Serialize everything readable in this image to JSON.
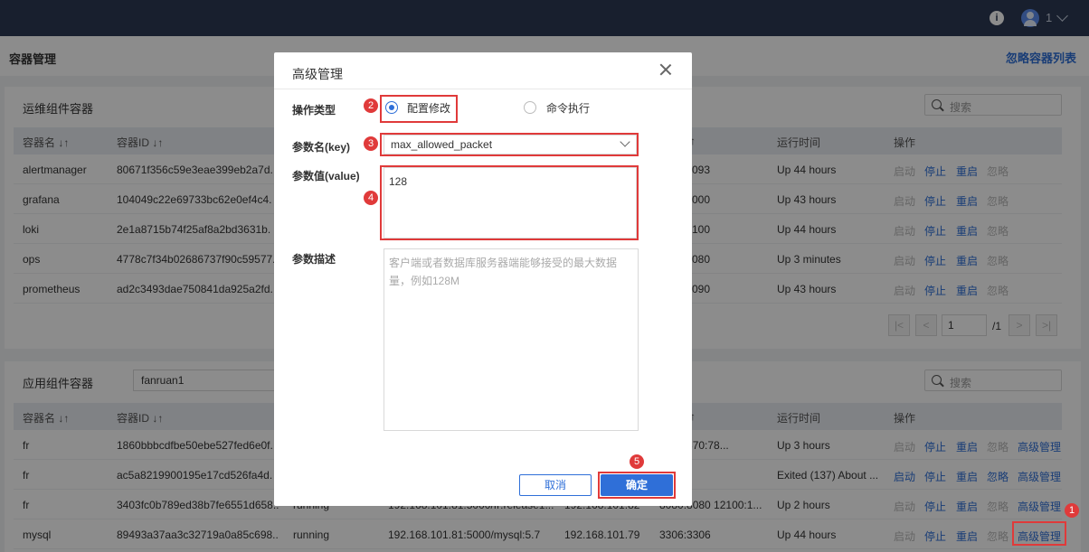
{
  "topbar": {
    "info": "i",
    "user": "1"
  },
  "page": {
    "title": "容器管理",
    "ignore_list": "忽略容器列表"
  },
  "panel1": {
    "title": "运维组件容器",
    "search_placeholder": "搜索",
    "headers": [
      "容器名 ↓↑",
      "容器ID ↓↑",
      "↑",
      "运行时间",
      "操作"
    ],
    "rows": [
      {
        "name": "alertmanager",
        "id": "80671f356c59e3eae399eb2a7d.",
        "port": "093",
        "uptime": "Up 44 hours"
      },
      {
        "name": "grafana",
        "id": "104049c22e69733bc62e0ef4c4.",
        "port": "000",
        "uptime": "Up 43 hours"
      },
      {
        "name": "loki",
        "id": "2e1a8715b74f25af8a2bd3631b.",
        "port": "100",
        "uptime": "Up 44 hours"
      },
      {
        "name": "ops",
        "id": "4778c7f34b02686737f90c59577.",
        "port": "080",
        "uptime": "Up 3 minutes"
      },
      {
        "name": "prometheus",
        "id": "ad2c3493dae750841da925a2fd.",
        "port": "090",
        "uptime": "Up 43 hours"
      }
    ],
    "actions": {
      "start": "启动",
      "stop": "停止",
      "restart": "重启",
      "ignore": "忽略"
    },
    "pager": {
      "first": "|<",
      "prev": "<",
      "page": "1",
      "total": "/1",
      "next": ">",
      "last": ">|"
    }
  },
  "panel2": {
    "title": "应用组件容器",
    "filter": "fanruan1",
    "search_placeholder": "搜索",
    "headers": [
      "容器名 ↓↑",
      "容器ID ↓↑",
      "↑",
      "运行时间",
      "操作"
    ],
    "rows": [
      {
        "name": "fr",
        "id": "1860bbbcdfbe50ebe527fed6e0f.",
        "status": "",
        "image": "",
        "ip": "",
        "port": "850 7870:78...",
        "uptime": "Up 3 hours"
      },
      {
        "name": "fr",
        "id": "ac5a8219900195e17cd526fa4d.",
        "status": "",
        "image": "",
        "ip": "",
        "port": "",
        "uptime": "Exited (137) About ..."
      },
      {
        "name": "fr",
        "id": "3403fc0b789ed38b7fe6551d658...",
        "status": "running",
        "image": "192.168.101.81:5000/fr:release1...",
        "ip": "192.168.101.82",
        "port": "8080:8080 12100:1...",
        "uptime": "Up 2 hours"
      },
      {
        "name": "mysql",
        "id": "89493a37aa3c32719a0a85c698...",
        "status": "running",
        "image": "192.168.101.81:5000/mysql:5.7",
        "ip": "192.168.101.79",
        "port": "3306:3306",
        "uptime": "Up 44 hours"
      }
    ],
    "actions": {
      "start": "启动",
      "stop": "停止",
      "restart": "重启",
      "ignore": "忽略",
      "advanced": "高级管理"
    }
  },
  "modal": {
    "title": "高级管理",
    "op_type_label": "操作类型",
    "op_config": "配置修改",
    "op_command": "命令执行",
    "key_label": "参数名(key)",
    "key_value": "max_allowed_packet",
    "value_label": "参数值(value)",
    "value_value": "128",
    "desc_label": "参数描述",
    "desc_value": "客户端或者数据库服务器端能够接受的最大数据量，例如128M",
    "cancel": "取消",
    "confirm": "确定"
  },
  "badges": [
    "1",
    "2",
    "3",
    "4",
    "5"
  ],
  "colors": {
    "accent": "#2f6fd8",
    "highlight": "#e03a3a",
    "topbar": "#2d3a55"
  }
}
